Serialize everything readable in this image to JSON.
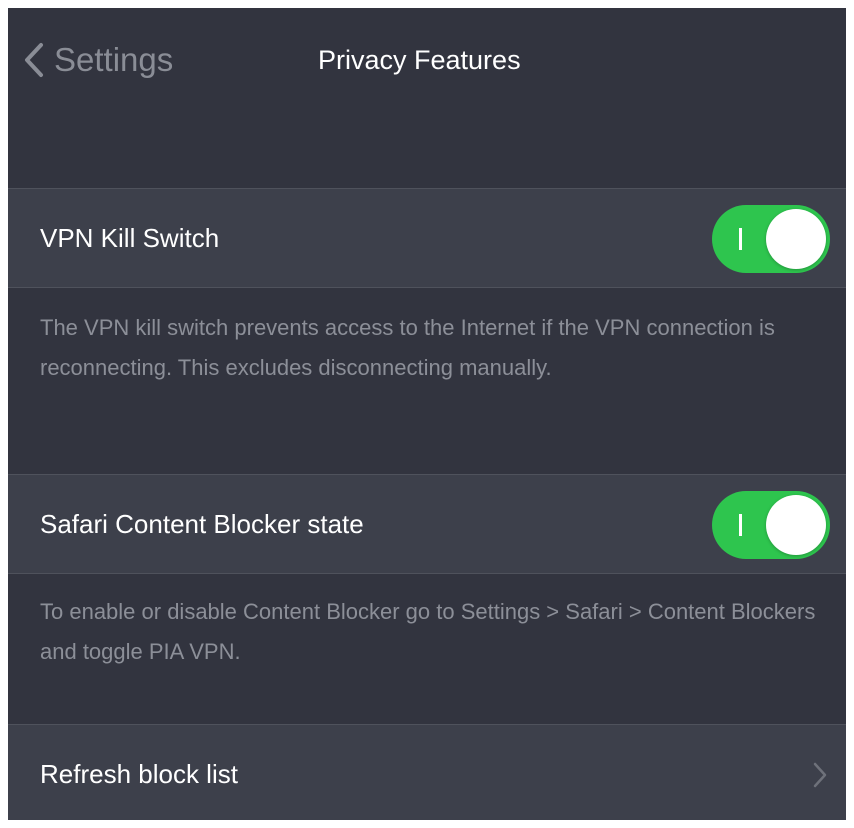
{
  "navbar": {
    "back_label": "Settings",
    "title": "Privacy Features"
  },
  "rows": [
    {
      "label": "VPN Kill Switch",
      "toggle_on": true,
      "description": "The VPN kill switch prevents access to the Internet if the VPN connection is reconnecting. This excludes disconnecting manually."
    },
    {
      "label": "Safari Content Blocker state",
      "toggle_on": true,
      "description": "To enable or disable Content Blocker go to Settings > Safari > Content Blockers and toggle PIA VPN."
    },
    {
      "label": "Refresh block list"
    }
  ],
  "colors": {
    "background": "#32343f",
    "row_background": "#3d404b",
    "toggle_on": "#2ec54e",
    "secondary_text": "#8c8f98"
  },
  "icons": {
    "back": "chevron-left-icon",
    "disclosure": "chevron-right-icon"
  }
}
